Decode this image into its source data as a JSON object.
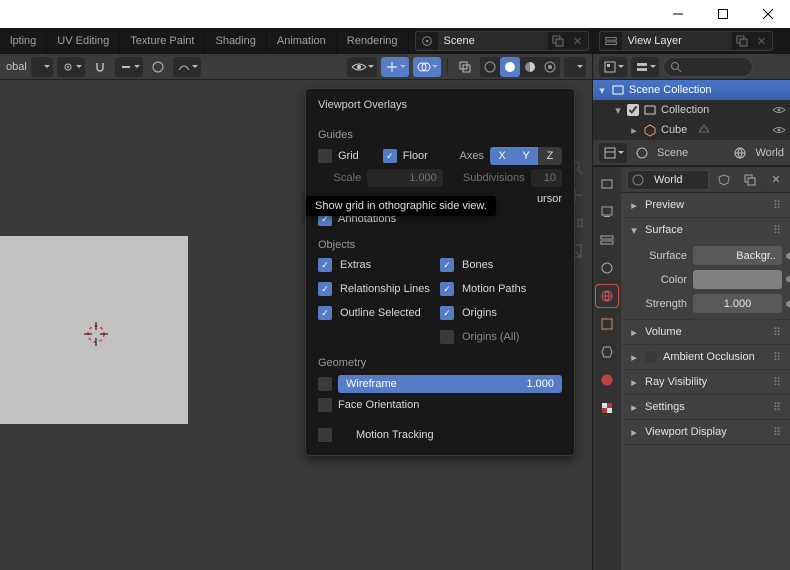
{
  "window": {
    "platform_buttons": [
      "minimize",
      "maximize",
      "close"
    ]
  },
  "workspace_tabs": [
    "lpting",
    "UV Editing",
    "Texture Paint",
    "Shading",
    "Animation",
    "Rendering"
  ],
  "top": {
    "scene_field": "Scene",
    "viewlayer_field": "View Layer"
  },
  "viewport_header": {
    "orientation": "obal"
  },
  "tooltip": "Show grid in othographic side view.",
  "overlays": {
    "title": "Viewport Overlays",
    "sections": {
      "guides": {
        "label": "Guides",
        "grid": {
          "label": "Grid",
          "checked": false
        },
        "floor": {
          "label": "Floor",
          "checked": true
        },
        "axes_label": "Axes",
        "axes": {
          "X": true,
          "Y": true,
          "Z": false
        },
        "scale": {
          "label": "Scale",
          "value": "1.000"
        },
        "subdivisions": {
          "label": "Subdivisions",
          "value": "10"
        },
        "cursor_label": "ursor",
        "annotations": {
          "label": "Annotations",
          "checked": true
        }
      },
      "objects": {
        "label": "Objects",
        "left": [
          {
            "label": "Extras",
            "checked": true
          },
          {
            "label": "Relationship Lines",
            "checked": true
          },
          {
            "label": "Outline Selected",
            "checked": true
          }
        ],
        "right": [
          {
            "label": "Bones",
            "checked": true
          },
          {
            "label": "Motion Paths",
            "checked": true
          },
          {
            "label": "Origins",
            "checked": true
          },
          {
            "label": "Origins (All)",
            "checked": false
          }
        ]
      },
      "geometry": {
        "label": "Geometry",
        "wireframe": {
          "label": "Wireframe",
          "value": "1.000",
          "checked": false
        },
        "face_orientation": {
          "label": "Face Orientation",
          "checked": false
        },
        "motion_tracking": {
          "label": "Motion Tracking",
          "checked": false
        }
      }
    }
  },
  "outliner": {
    "root": "Scene Collection",
    "collection": "Collection",
    "items": [
      "Cube"
    ]
  },
  "properties_context": {
    "scene_crumb": "Scene",
    "world_crumb": "World"
  },
  "properties": {
    "datablock": "World",
    "panels": {
      "preview": "Preview",
      "surface": {
        "title": "Surface",
        "surface_label": "Surface",
        "surface_value": "Backgr..",
        "color_label": "Color",
        "strength_label": "Strength",
        "strength_value": "1.000"
      },
      "volume": "Volume",
      "ambient_occlusion": "Ambient Occlusion",
      "ray_visibility": "Ray Visibility",
      "settings": "Settings",
      "viewport_display": "Viewport Display"
    }
  }
}
